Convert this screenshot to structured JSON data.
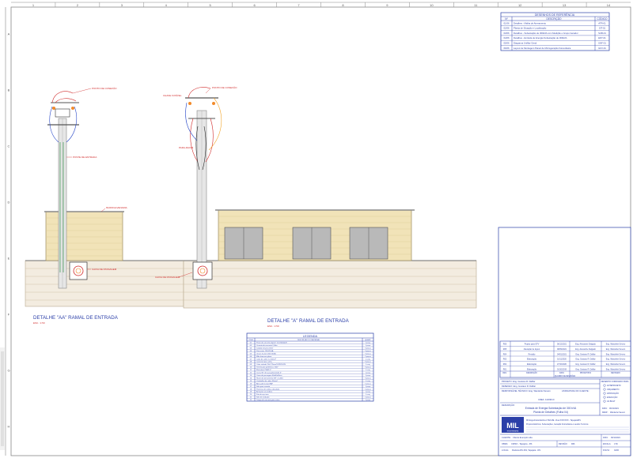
{
  "grid": {
    "columns": [
      "1",
      "2",
      "3",
      "4",
      "5",
      "6",
      "7",
      "8",
      "9",
      "10",
      "11",
      "12",
      "13",
      "14"
    ],
    "rows": [
      "A",
      "B",
      "C",
      "D",
      "E",
      "F",
      "G",
      "H"
    ]
  },
  "ref_table": {
    "title": "DESENHOS DE REFERÊNCIA",
    "headers": [
      "Nº",
      "DESCRIÇÃO",
      "CÓDIGO"
    ],
    "rows": [
      [
        "01/06",
        "Detalhes - Malha de Aterramento",
        "ATR-01"
      ],
      [
        "02/06",
        "Planta de Situação e Localização",
        "SIT-01"
      ],
      [
        "03/06",
        "Detalhes - Subestação de 300kVA com Medição e Grupo Gerador",
        "SUB-01"
      ],
      [
        "04/06",
        "Detalhes - Entrada de Energia Subestação de 300kVA",
        "ENT-01"
      ],
      [
        "05/06",
        "Diagrama Unifilar Geral",
        "UNF-01"
      ],
      [
        "06/06",
        "Layout de Montagem Painel de Microgeração Fotovoltaica",
        "GFV-01"
      ]
    ]
  },
  "labels": {
    "detail_aa": "DETALHE \"AA\" RAMAL DE ENTRADA",
    "detail_aa_scale": "ESC.: 1:50",
    "detail_a": "DETALHE \"A\" RAMAL DE ENTRADA",
    "detail_a_scale": "ESC.: 1:50",
    "poste_entrada": "POSTE DE ENTRADA",
    "muro_alvenaria": "MURO/ALVENARIA",
    "caixa_passagem": "CAIXA DE PASSAGEM"
  },
  "legend": {
    "title": "LEGENDA",
    "headers": [
      "ITEM",
      "DESCRIÇÃO DO MATERIAL",
      "QUANT."
    ],
    "rows": [
      [
        "01",
        "Poste de concreto duplo T 11m/600daN",
        "1 peça"
      ],
      [
        "02",
        "Cruzeta de concreto 2,00m",
        "1 peça"
      ],
      [
        "03",
        "Isolador de pino 15kV",
        "3 peças"
      ],
      [
        "04",
        "Para-raios 12kV/10kA",
        "3 peças"
      ],
      [
        "05",
        "Chave fusível 15kV/100A",
        "3 peças"
      ],
      [
        "06",
        "Mão francesa plana",
        "2 peças"
      ],
      [
        "07",
        "Cabo de cobre nu 50mm²",
        "1 conj."
      ],
      [
        "08",
        "Conector tipo cunha",
        "6 peças"
      ],
      [
        "09",
        "Cabo isolado 15kV 25mm² EPR/XLPE",
        "1 conj."
      ],
      [
        "10",
        "Terminação polimérica 15kV",
        "3 peças"
      ],
      [
        "11",
        "Eletroduto PEAD 4\"",
        "1 conj."
      ],
      [
        "12",
        "Curva 90° de aço galvanizado 4\"",
        "1 peça"
      ],
      [
        "13",
        "Caixa de passagem 60x60x60cm",
        "1 peça"
      ],
      [
        "14",
        "Haste de aterramento 5/8\" x 2,40m",
        "3 peças"
      ],
      [
        "15",
        "Cordoalha de cobre 50mm²",
        "1 conj."
      ],
      [
        "16",
        "Abraçadeira tipo BAP",
        "4 peças"
      ],
      [
        "17",
        "Sela para cruzeta",
        "1 peça"
      ],
      [
        "18",
        "Parafuso de cabeça abaulada",
        "4 peças"
      ],
      [
        "19",
        "Armação secundária",
        "1 peça"
      ],
      [
        "20",
        "Fita de aço inox",
        "1 conj."
      ],
      [
        "21",
        "Selo de vedação",
        "2 peças"
      ],
      [
        "22",
        "Tampa de concreto para caixa",
        "1 peça"
      ]
    ]
  },
  "revisions": {
    "headers": [
      "REV.",
      "DESCRIÇÃO",
      "DATA",
      "PROJETISTA",
      "REVISADO"
    ],
    "rows": [
      [
        "R06",
        "Projeto para GFV",
        "06/12/2021",
        "Eng. Alexandre Delgado",
        "Eng. Wanderlei Severo"
      ],
      [
        "R05",
        "Alteração de layout",
        "08/09/2021",
        "Eng. Alexandre Delgado",
        "Eng. Wanderlei Severo"
      ],
      [
        "R04",
        "Revisão",
        "04/01/2021",
        "Eng. Gustavo R. Dalfiar",
        "Eng. Wanderlei Severo"
      ],
      [
        "R03",
        "Elaboração",
        "16/11/2020",
        "Eng. Gustavo R. Dalfiar",
        "Eng. Wanderlei Severo"
      ],
      [
        "R02",
        "Elaboração",
        "27/10/2020",
        "Eng. Gustavo R. Dalfiar",
        "Eng. Wanderlei Severo"
      ],
      [
        "R01",
        "Elaboração",
        "01/10/2019",
        "Eng. Gustavo R. Dalfiar",
        "Eng. Wanderlei Severo"
      ]
    ],
    "footer": "QUADRO DE REVISÕES"
  },
  "title_block": {
    "projeto": "PROJETO: Eng. Gustavo R. Dalfiar",
    "desenho": "DESENHO: Eng. Gustavo R. Dalfiar",
    "resp": "RESPONSÁVEL TÉCNICO: Eng. Wanderlei Severo",
    "crea": "CREA: 114090-D",
    "assinatura": "ASSINATURA DO CLIENTE:",
    "descricao_label": "DESCRIÇÃO:",
    "descricao": "Entrada de Energia Subestação de 300 kVA",
    "descricao2": "Planta de Detalhes (Folha 04)",
    "status_title": "DESENHO CORRIGIDO PARA",
    "status_options": [
      "ANTEPROJETO",
      "ORÇAMENTO",
      "APROVAÇÃO",
      "EXECUÇÃO",
      "AS BUILT"
    ],
    "status_date_label": "DATA:",
    "status_date": "06/12/2021",
    "status_resp_label": "RESP.:",
    "status_resp": "Wanderlei Severo",
    "company": "MIL",
    "company_tag": "ENGENHARIA",
    "company_line1": "Mil Engenharia Elétrica LTDA ME - Rua XXXXXXX - Tapejara/RS",
    "company_line2": "Projetos Elétricos, Subestações, Geração Fotovoltaica e Laudos Técnicos",
    "cliente_label": "CLIENTE:",
    "cliente": "Cliente Exemplo Ltda",
    "obra_label": "OBRA:",
    "obra": "CIRSO - Tapejara - RS",
    "local_label": "LOCAL:",
    "local": "Rodovia RS 463, Tapejara - RS",
    "data_label": "DATA:",
    "data": "06/12/2021",
    "rev_label": "REVISÃO:",
    "rev": "R06",
    "folha_label": "FOLHA:",
    "folha": "04/06",
    "escala_label": "ESCALA:",
    "escala": "1:50"
  }
}
